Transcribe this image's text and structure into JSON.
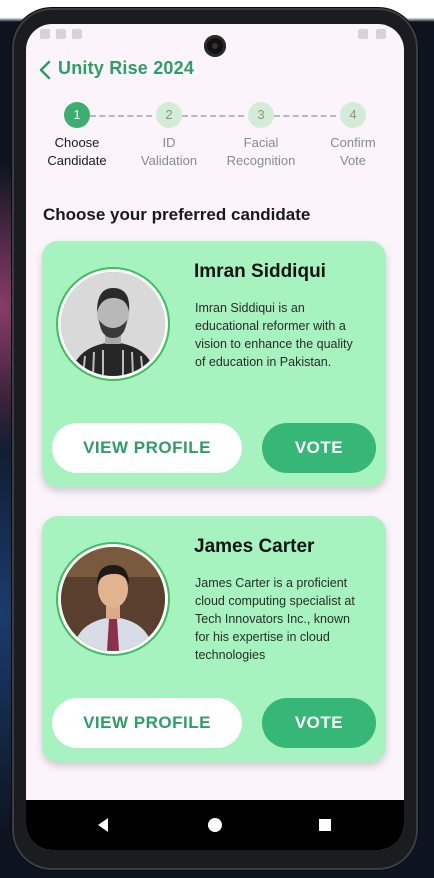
{
  "app": {
    "title": "Unity Rise 2024"
  },
  "stepper": {
    "steps": [
      {
        "number": "1",
        "label_line1": "Choose",
        "label_line2": "Candidate",
        "active": true
      },
      {
        "number": "2",
        "label_line1": "ID",
        "label_line2": "Validation",
        "active": false
      },
      {
        "number": "3",
        "label_line1": "Facial",
        "label_line2": "Recognition",
        "active": false
      },
      {
        "number": "4",
        "label_line1": "Confirm",
        "label_line2": "Vote",
        "active": false
      }
    ]
  },
  "section_title": "Choose your preferred candidate",
  "candidates": [
    {
      "name": "Imran Siddiqui",
      "bio": "Imran Siddiqui is an educational reformer with a vision to enhance the quality of education in Pakistan.",
      "view_profile_label": "VIEW PROFILE",
      "vote_label": "VOTE"
    },
    {
      "name": "James Carter",
      "bio": "James Carter is a proficient cloud computing specialist at Tech Innovators Inc., known for his expertise in cloud technologies",
      "view_profile_label": "VIEW PROFILE",
      "vote_label": "VOTE"
    }
  ],
  "colors": {
    "brand_green": "#2e9e67",
    "card_background": "#a6f3c0",
    "vote_button": "#37b777",
    "active_step": "#3cae6f",
    "inactive_step": "#d3ecd6",
    "screen_background": "#fbf5fb"
  },
  "icons": {
    "back": "chevron-left-icon",
    "nav_back": "triangle-back-icon",
    "nav_home": "circle-home-icon",
    "nav_recents": "square-recents-icon"
  }
}
